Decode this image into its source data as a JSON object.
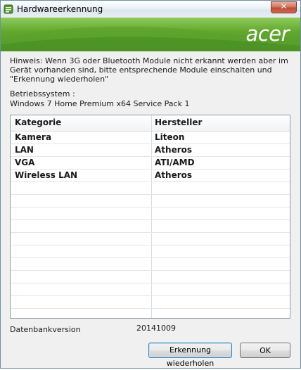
{
  "window": {
    "title": "Hardwareerkennung",
    "close_label": "✕"
  },
  "banner": {
    "logo": "acer"
  },
  "hint": "Hinweis: Wenn 3G oder Bluetooth Module nicht erkannt werden aber im Gerät vorhanden sind, bitte entsprechende Module einschalten und \"Erkennung wiederholen\"",
  "os": {
    "label": "Betriebssystem :",
    "value": "Windows 7 Home Premium x64 Service Pack 1"
  },
  "table": {
    "headers": [
      "Kategorie",
      "Hersteller"
    ],
    "rows": [
      {
        "category": "Kamera",
        "manufacturer": "Liteon"
      },
      {
        "category": "LAN",
        "manufacturer": "Atheros"
      },
      {
        "category": "VGA",
        "manufacturer": "ATI/AMD"
      },
      {
        "category": "Wireless LAN",
        "manufacturer": "Atheros"
      }
    ]
  },
  "database": {
    "label": "Datenbankversion",
    "value": "20141009"
  },
  "buttons": {
    "redo": "Erkennung wiederholen",
    "ok": "OK"
  },
  "colors": {
    "banner_green": "#63a92f",
    "close_red": "#c24a2f"
  }
}
